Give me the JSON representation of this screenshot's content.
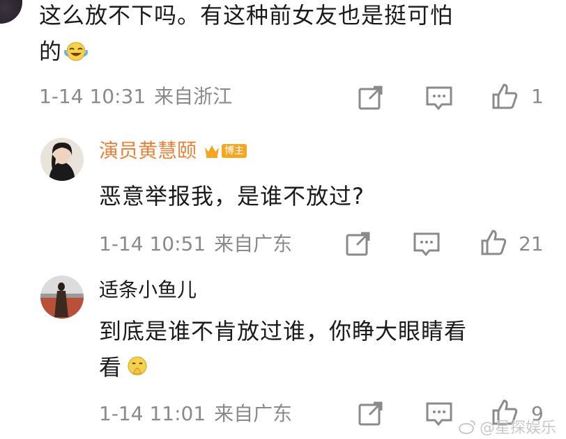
{
  "comments": [
    {
      "text_line1": "这么放不下吗。有这种前女友也是挺可怕",
      "text_line2": "的",
      "time": "1-14 10:31",
      "source": "来自浙江",
      "likes": "1"
    },
    {
      "username": "演员黄慧颐",
      "badge": "博主",
      "text_line1": "恶意举报我，是谁不放过?",
      "time": "1-14 10:51",
      "source": "来自广东",
      "likes": "21",
      "username_color": "#e8803a"
    },
    {
      "username": "适条小鱼儿",
      "text_line1": "到底是谁不肯放过谁，你睁大眼睛看",
      "text_line2": "看",
      "time": "1-14 11:01",
      "source": "来自广东",
      "likes": "9"
    }
  ],
  "watermark": "@星探娱乐",
  "icons": [
    "share-icon",
    "comment-icon",
    "like-icon",
    "laugh-cry-emoji",
    "pray-emoji",
    "crown-icon",
    "weibo-icon"
  ],
  "colors": {
    "meta": "#8a8a8a",
    "text": "#1a1a1a",
    "vip": "#e8803a"
  }
}
